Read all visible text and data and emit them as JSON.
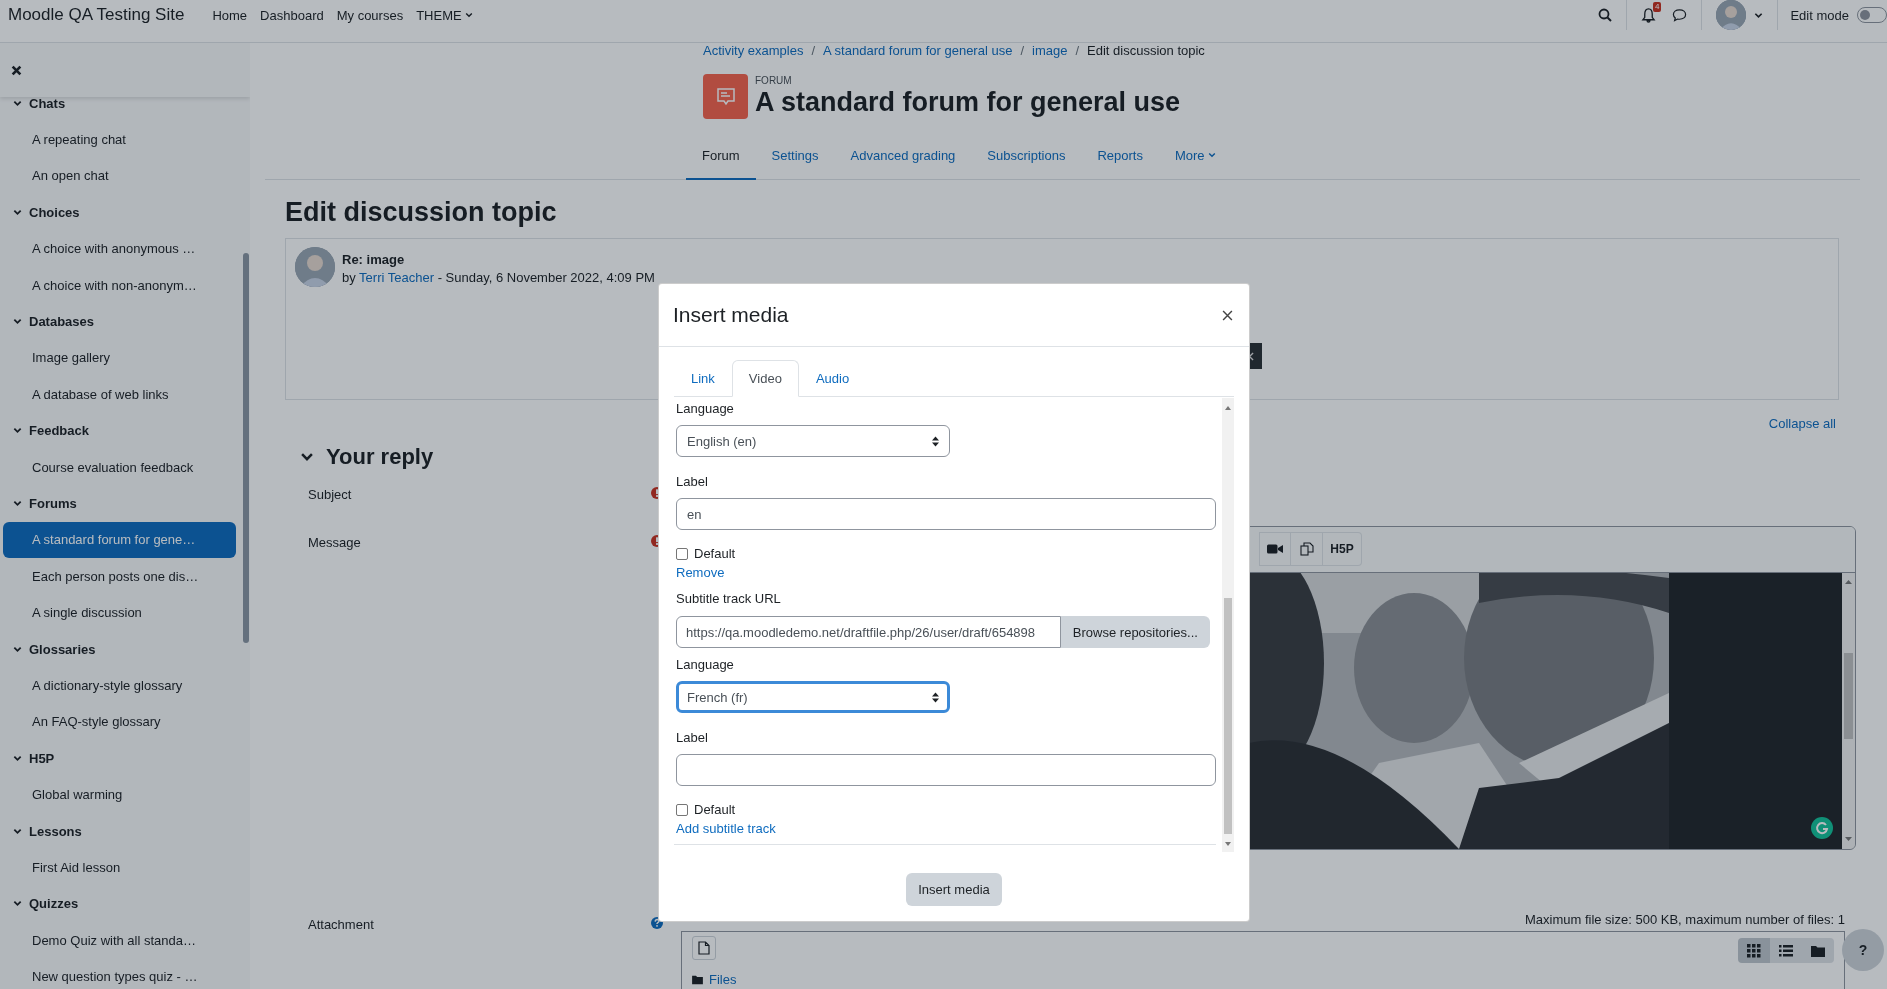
{
  "navbar": {
    "site_name": "Moodle QA Testing Site",
    "links": [
      {
        "label": "Home"
      },
      {
        "label": "Dashboard"
      },
      {
        "label": "My courses"
      },
      {
        "label": "THEME",
        "dropdown": true
      }
    ],
    "notification_count": "4",
    "edit_mode": {
      "label": "Edit mode",
      "on": false
    }
  },
  "sidebar": {
    "items": [
      {
        "label": "Chats",
        "expanded": true,
        "children": [
          {
            "label": "A repeating chat",
            "selected": false
          },
          {
            "label": "An open chat",
            "selected": false
          }
        ]
      },
      {
        "label": "Choices",
        "expanded": true,
        "children": [
          {
            "label": "A choice with anonymous …",
            "selected": false
          },
          {
            "label": "A choice with non-anonym…",
            "selected": false
          }
        ]
      },
      {
        "label": "Databases",
        "expanded": true,
        "children": [
          {
            "label": "Image gallery",
            "selected": false
          },
          {
            "label": "A database of web links",
            "selected": false
          }
        ]
      },
      {
        "label": "Feedback",
        "expanded": true,
        "children": [
          {
            "label": "Course evaluation feedback",
            "selected": false
          }
        ]
      },
      {
        "label": "Forums",
        "expanded": true,
        "children": [
          {
            "label": "A standard forum for gene…",
            "selected": true
          },
          {
            "label": "Each person posts one dis…",
            "selected": false
          },
          {
            "label": "A single discussion",
            "selected": false
          }
        ]
      },
      {
        "label": "Glossaries",
        "expanded": true,
        "children": [
          {
            "label": "A dictionary-style glossary",
            "selected": false
          },
          {
            "label": "An FAQ-style glossary",
            "selected": false
          }
        ]
      },
      {
        "label": "H5P",
        "expanded": true,
        "children": [
          {
            "label": "Global warming",
            "selected": false
          }
        ]
      },
      {
        "label": "Lessons",
        "expanded": true,
        "children": [
          {
            "label": "First Aid lesson",
            "selected": false
          }
        ]
      },
      {
        "label": "Quizzes",
        "expanded": true,
        "children": [
          {
            "label": "Demo Quiz with all standa…",
            "selected": false
          },
          {
            "label": "New question types quiz - …",
            "selected": false
          }
        ]
      }
    ]
  },
  "breadcrumb": {
    "items": [
      "Activity examples",
      "A standard forum for general use",
      "image",
      "Edit discussion topic"
    ],
    "separator": "/"
  },
  "activity": {
    "type_label": "FORUM",
    "title": "A standard forum for general use"
  },
  "tabs": [
    {
      "label": "Forum",
      "selected": true
    },
    {
      "label": "Settings",
      "selected": false
    },
    {
      "label": "Advanced grading",
      "selected": false
    },
    {
      "label": "Subscriptions",
      "selected": false
    },
    {
      "label": "Reports",
      "selected": false
    },
    {
      "label": "More",
      "selected": false,
      "dropdown": true
    }
  ],
  "page_title": "Edit discussion topic",
  "post": {
    "subject": "Re: image",
    "by": "by",
    "author": "Terri Teacher",
    "date": "- Sunday, 6 November 2022, 4:09 PM"
  },
  "collapse_all": "Collapse all",
  "section": {
    "title": "Your reply",
    "expanded": true
  },
  "fields": [
    {
      "label": "Subject",
      "kind": "required"
    },
    {
      "label": "Message",
      "kind": "required"
    },
    {
      "label": "Attachment",
      "kind": "help"
    }
  ],
  "editor": {
    "h5p_label": "H5P"
  },
  "attachment": {
    "limits": "Maximum file size: 500 KB, maximum number of files: 1",
    "folder": "Files",
    "views": [
      {
        "selected": true
      },
      {
        "selected": false
      },
      {
        "selected": false
      }
    ]
  },
  "help_button": "?",
  "modal": {
    "title": "Insert media",
    "tabs": [
      {
        "label": "Link",
        "selected": false
      },
      {
        "label": "Video",
        "selected": true
      },
      {
        "label": "Audio",
        "selected": false
      }
    ],
    "fields": [
      {
        "kind": "select",
        "label": "Language",
        "value": "English (en)",
        "focused": false
      },
      {
        "kind": "text",
        "label": "Label",
        "value": "en"
      },
      {
        "kind": "checkbox",
        "label": "Default",
        "checked": false
      },
      {
        "kind": "link",
        "label": "Remove"
      },
      {
        "kind": "url",
        "label": "Subtitle track URL",
        "value": "https://qa.moodledemo.net/draftfile.php/26/user/draft/654898",
        "button": "Browse repositories..."
      },
      {
        "kind": "select",
        "label": "Language",
        "value": "French (fr)",
        "focused": true
      },
      {
        "kind": "text",
        "label": "Label"
      },
      {
        "kind": "checkbox",
        "label": "Default",
        "checked": false
      },
      {
        "kind": "link",
        "label": "Add subtitle track"
      }
    ],
    "submit": "Insert media"
  }
}
